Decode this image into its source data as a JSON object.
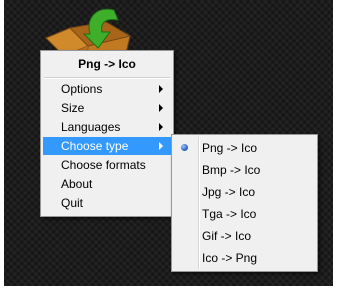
{
  "colors": {
    "highlight": "#3399ff",
    "menu_bg": "#f0f0f0",
    "desktop_bg": "#1c1c1c"
  },
  "menu": {
    "title": "Png -> Ico",
    "items": [
      {
        "label": "Options",
        "submenu": true
      },
      {
        "label": "Size",
        "submenu": true
      },
      {
        "label": "Languages",
        "submenu": true
      },
      {
        "label": "Choose type",
        "submenu": true,
        "highlighted": true
      },
      {
        "label": "Choose formats",
        "submenu": false
      },
      {
        "label": "About",
        "submenu": false
      },
      {
        "label": "Quit",
        "submenu": false
      }
    ]
  },
  "submenu": {
    "items": [
      {
        "label": "Png -> Ico",
        "selected": true
      },
      {
        "label": "Bmp -> Ico",
        "selected": false
      },
      {
        "label": "Jpg -> Ico",
        "selected": false
      },
      {
        "label": "Tga -> Ico",
        "selected": false
      },
      {
        "label": "Gif -> Ico",
        "selected": false
      },
      {
        "label": "Ico -> Png",
        "selected": false
      }
    ]
  }
}
